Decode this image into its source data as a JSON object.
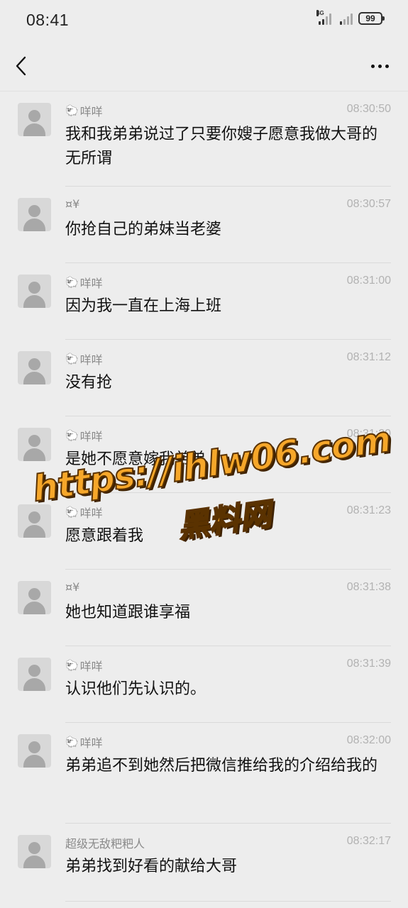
{
  "status_bar": {
    "time": "08:41",
    "network": "4G",
    "battery": "99"
  },
  "nav": {
    "back_icon": "chevron-left-icon",
    "more_icon": "more-dots-icon"
  },
  "messages": [
    {
      "sender": "咩咩",
      "sender_emoji": "🐑",
      "time": "08:30:50",
      "text": "我和我弟弟说过了只要你嫂子愿意我做大哥的无所谓"
    },
    {
      "sender": "¤¥",
      "sender_emoji": "",
      "time": "08:30:57",
      "text": "你抢自己的弟妹当老婆"
    },
    {
      "sender": "咩咩",
      "sender_emoji": "🐑",
      "time": "08:31:00",
      "text": "因为我一直在上海上班"
    },
    {
      "sender": "咩咩",
      "sender_emoji": "🐑",
      "time": "08:31:12",
      "text": "没有抢"
    },
    {
      "sender": "咩咩",
      "sender_emoji": "🐑",
      "time": "08:31:20",
      "text": "是她不愿意嫁我弟弟"
    },
    {
      "sender": "咩咩",
      "sender_emoji": "🐑",
      "time": "08:31:23",
      "text": "愿意跟着我"
    },
    {
      "sender": "¤¥",
      "sender_emoji": "",
      "time": "08:31:38",
      "text": "她也知道跟谁享福"
    },
    {
      "sender": "咩咩",
      "sender_emoji": "🐑",
      "time": "08:31:39",
      "text": "认识他们先认识的。"
    },
    {
      "sender": "咩咩",
      "sender_emoji": "🐑",
      "time": "08:32:00",
      "text": "弟弟追不到她然后把微信推给我的介绍给我的"
    },
    {
      "sender": "超级无敌粑粑人",
      "sender_emoji": "",
      "time": "08:32:17",
      "text": "弟弟找到好看的献给大哥"
    }
  ],
  "watermark": {
    "line1": "https://ihlw06.com",
    "line2": "黑料网"
  }
}
